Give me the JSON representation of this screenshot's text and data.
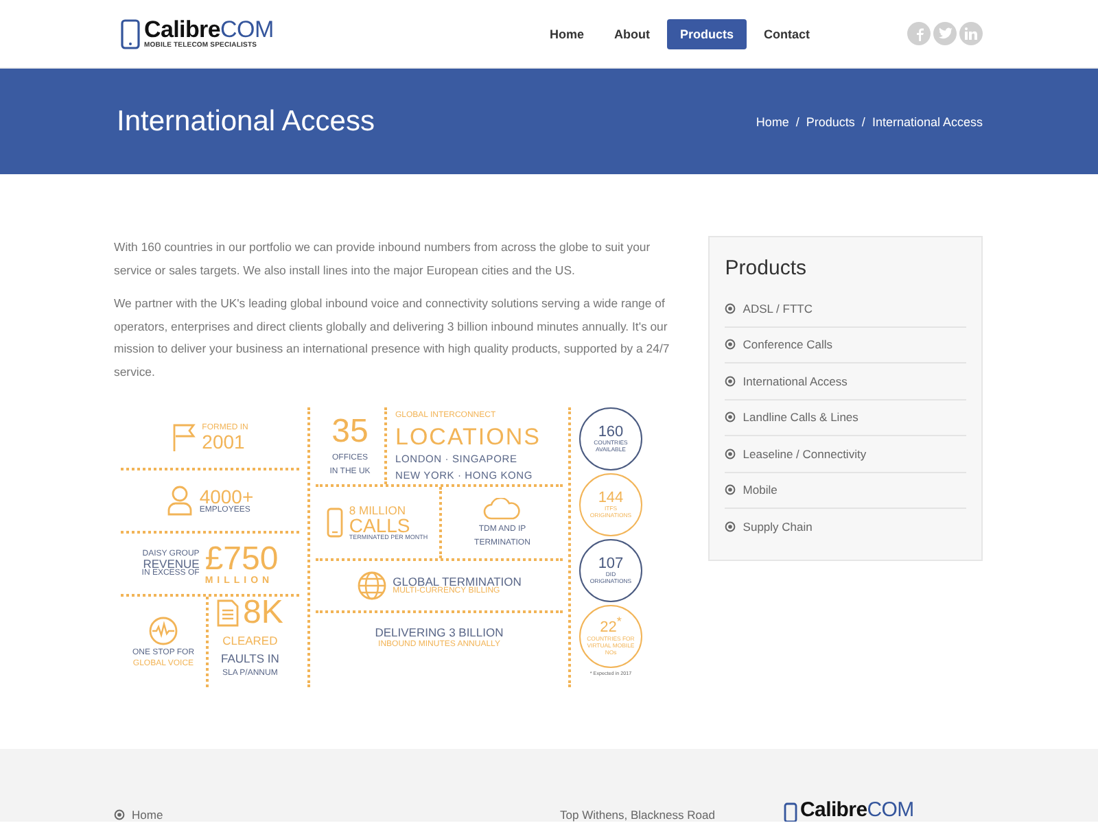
{
  "header": {
    "logo": {
      "name": "Calibre",
      "suffix": "COM",
      "tagline": "MOBILE TELECOM SPECIALISTS"
    },
    "nav": [
      {
        "label": "Home",
        "selected": false
      },
      {
        "label": "About",
        "selected": false
      },
      {
        "label": "Products",
        "selected": true
      },
      {
        "label": "Contact",
        "selected": false
      }
    ]
  },
  "banner": {
    "title": "International Access",
    "breadcrumb": [
      "Home",
      "Products",
      "International Access"
    ],
    "separator": "/"
  },
  "intro": [
    "With 160 countries in our portfolio we can provide inbound numbers from across the globe to suit your service or sales targets. We also install lines into the major European cities and the US.",
    "We partner with the UK's leading global inbound voice and connectivity solutions serving a wide range of operators, enterprises and direct clients globally and delivering 3 billion inbound minutes annually. It's our mission to deliver your business an international presence with high quality products, supported by a 24/7 service."
  ],
  "infographic": {
    "founded": {
      "caption": "FORMED IN",
      "value": "2001"
    },
    "employees": {
      "value": "4000+",
      "caption": "EMPLOYEES"
    },
    "revenue": {
      "lines": [
        "DAISY GROUP",
        "REVENUE",
        "IN EXCESS OF"
      ],
      "value": "£750",
      "unit": "MILLION"
    },
    "voice": {
      "line1": "ONE STOP FOR",
      "line2": "GLOBAL VOICE"
    },
    "faults": {
      "value": "8K",
      "lines": [
        "CLEARED",
        "FAULTS IN"
      ],
      "caption": "SLA P/ANNUM"
    },
    "offices": {
      "value": "35",
      "caption": [
        "OFFICES",
        "IN THE UK"
      ]
    },
    "locations": {
      "heading": "GLOBAL INTERCONNECT",
      "title": "LOCATIONS",
      "cities": [
        "LONDON · SINGAPORE",
        "NEW YORK · HONG KONG"
      ]
    },
    "calls": {
      "line1": "8 MILLION",
      "line2": "CALLS",
      "caption": "TERMINATED PER MONTH"
    },
    "tdm": {
      "line1": "TDM AND IP",
      "line2": "TERMINATION"
    },
    "termination": {
      "title": "GLOBAL TERMINATION",
      "caption": "MULTI-CURRENCY BILLING"
    },
    "minutes": {
      "title": "DELIVERING 3 BILLION",
      "caption": "INBOUND MINUTES ANNUALLY"
    },
    "circles": [
      {
        "value": "160",
        "caption": "COUNTRIES AVAILABLE",
        "color": "#4a5a80"
      },
      {
        "value": "144",
        "caption": "ITFS ORIGINATIONS",
        "color": "#f2b457"
      },
      {
        "value": "107",
        "caption": "DID ORIGINATIONS",
        "color": "#4a5a80"
      },
      {
        "value": "22$^{*}$",
        "caption": "COUNTRIES FOR VIRTUAL MOBILE NOs",
        "color": "#f2b457"
      }
    ],
    "footnote": "* Expected in 2017"
  },
  "sidebar": {
    "title": "Products",
    "items": [
      "ADSL / FTTC",
      "Conference Calls",
      "International Access",
      "Landline Calls & Lines",
      "Leaseline / Connectivity",
      "Mobile",
      "Supply Chain"
    ]
  },
  "footer": {
    "links": [
      "Home"
    ],
    "address": "Top Withens, Blackness Road",
    "logo": {
      "name": "Calibre",
      "suffix": "COM"
    }
  }
}
